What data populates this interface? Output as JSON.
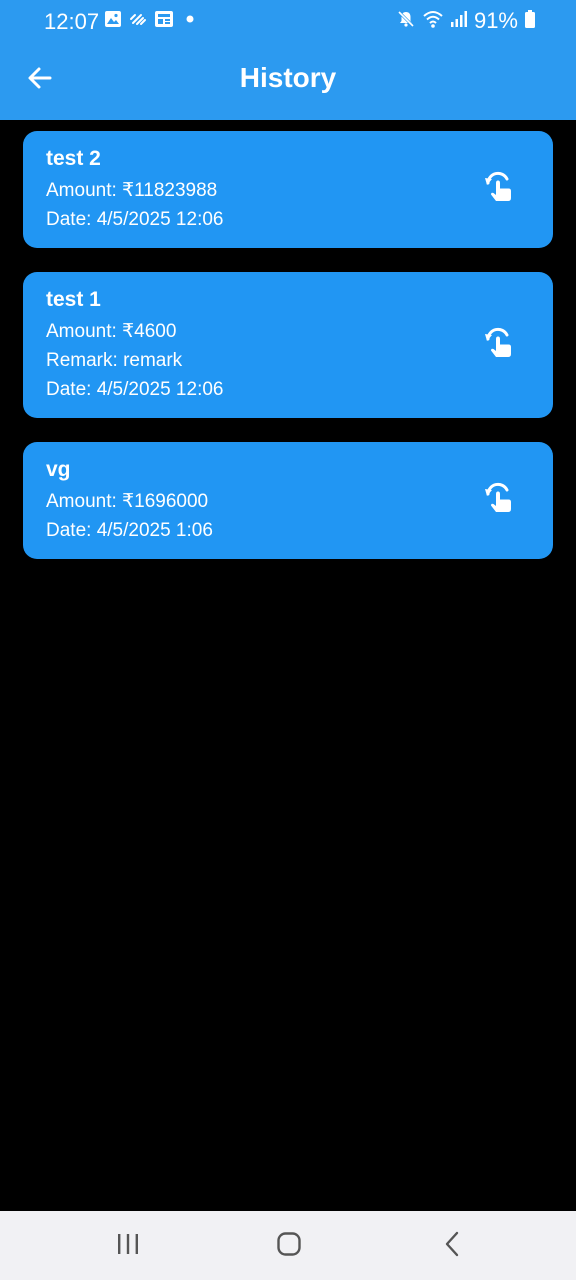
{
  "status_bar": {
    "time": "12:07",
    "battery": "91%",
    "icons": [
      "image-icon",
      "signal-activity-icon",
      "news-icon",
      "dot-icon",
      "mute-icon",
      "wifi-icon",
      "cell-signal-icon",
      "battery-icon"
    ]
  },
  "app_bar": {
    "title": "History",
    "back_icon": "arrow-left-icon"
  },
  "history": [
    {
      "title": "test 2",
      "amount": "Amount: ₹11823988",
      "date": "Date: 4/5/2025 12:06",
      "action_icon": "restore-touch-icon"
    },
    {
      "title": "test 1",
      "amount": "Amount: ₹4600",
      "remark": "Remark: remark",
      "date": "Date: 4/5/2025 12:06",
      "action_icon": "restore-touch-icon"
    },
    {
      "title": "vg",
      "amount": "Amount: ₹1696000",
      "date": "Date: 4/5/2025 1:06",
      "action_icon": "restore-touch-icon"
    }
  ],
  "colors": {
    "app_bar": "#2c9af0",
    "card": "#2196f3",
    "background": "#000000",
    "nav_bar": "#f1f1f4"
  }
}
